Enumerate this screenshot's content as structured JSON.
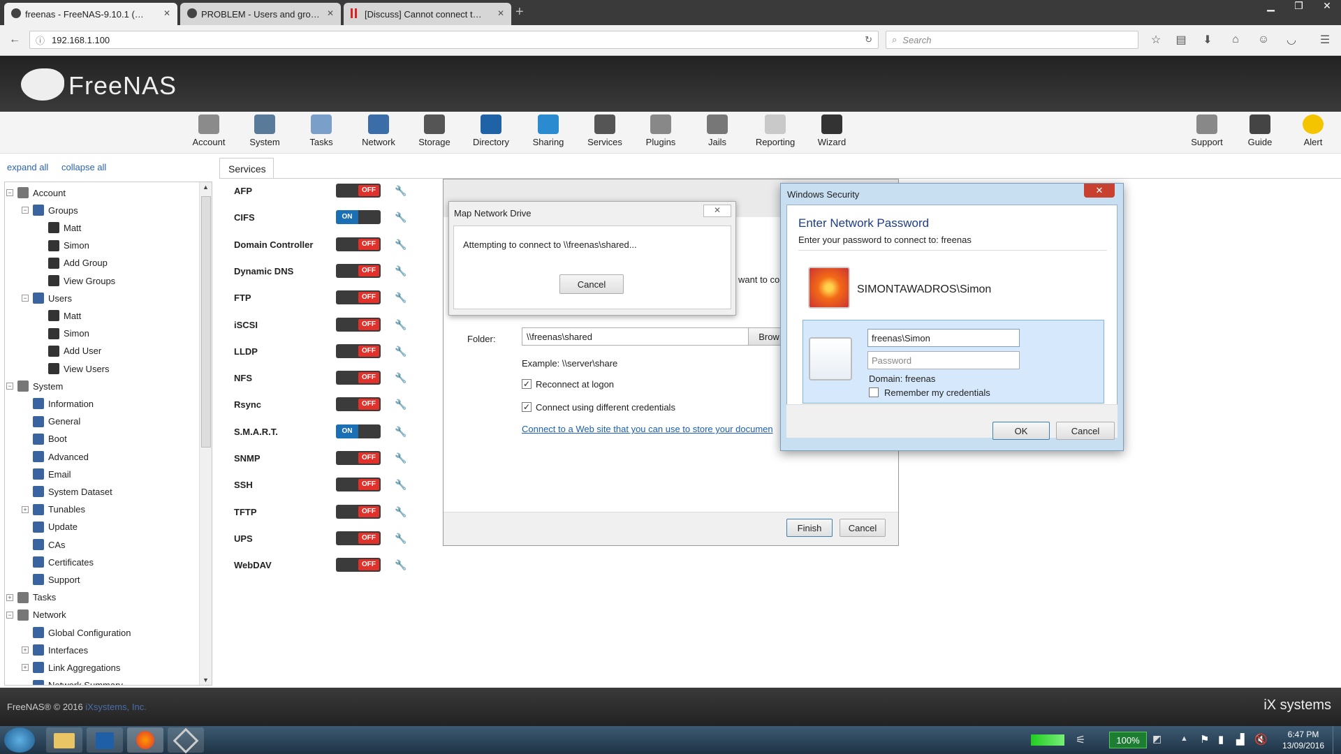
{
  "browser": {
    "tabs": [
      {
        "label": "freenas - FreeNAS-9.10.1 (…"
      },
      {
        "label": "PROBLEM - Users and gro…"
      },
      {
        "label": "[Discuss] Cannot connect t…"
      }
    ],
    "url": "192.168.1.100",
    "search_placeholder": "Search"
  },
  "app": {
    "logo": "FreeNAS",
    "toolbar": [
      "Account",
      "System",
      "Tasks",
      "Network",
      "Storage",
      "Directory",
      "Sharing",
      "Services",
      "Plugins",
      "Jails",
      "Reporting",
      "Wizard"
    ],
    "toolbar_right": [
      "Support",
      "Guide",
      "Alert"
    ],
    "expand_all": "expand all",
    "collapse_all": "collapse all",
    "tab_services": "Services"
  },
  "tree": [
    {
      "label": "Account",
      "level": 0,
      "pm": "−"
    },
    {
      "label": "Groups",
      "level": 1,
      "pm": "−"
    },
    {
      "label": "Matt",
      "level": 2
    },
    {
      "label": "Simon",
      "level": 2
    },
    {
      "label": "Add Group",
      "level": 2
    },
    {
      "label": "View Groups",
      "level": 2
    },
    {
      "label": "Users",
      "level": 1,
      "pm": "−"
    },
    {
      "label": "Matt",
      "level": 2
    },
    {
      "label": "Simon",
      "level": 2
    },
    {
      "label": "Add User",
      "level": 2
    },
    {
      "label": "View Users",
      "level": 2
    },
    {
      "label": "System",
      "level": 0,
      "pm": "−"
    },
    {
      "label": "Information",
      "level": 1
    },
    {
      "label": "General",
      "level": 1
    },
    {
      "label": "Boot",
      "level": 1
    },
    {
      "label": "Advanced",
      "level": 1
    },
    {
      "label": "Email",
      "level": 1
    },
    {
      "label": "System Dataset",
      "level": 1
    },
    {
      "label": "Tunables",
      "level": 1,
      "pm": "+"
    },
    {
      "label": "Update",
      "level": 1
    },
    {
      "label": "CAs",
      "level": 1
    },
    {
      "label": "Certificates",
      "level": 1
    },
    {
      "label": "Support",
      "level": 1
    },
    {
      "label": "Tasks",
      "level": 0,
      "pm": "+"
    },
    {
      "label": "Network",
      "level": 0,
      "pm": "−"
    },
    {
      "label": "Global Configuration",
      "level": 1
    },
    {
      "label": "Interfaces",
      "level": 1,
      "pm": "+"
    },
    {
      "label": "Link Aggregations",
      "level": 1,
      "pm": "+"
    },
    {
      "label": "Network Summary",
      "level": 1
    }
  ],
  "services": [
    {
      "name": "AFP",
      "state": "OFF"
    },
    {
      "name": "CIFS",
      "state": "ON"
    },
    {
      "name": "Domain Controller",
      "state": "OFF"
    },
    {
      "name": "Dynamic DNS",
      "state": "OFF"
    },
    {
      "name": "FTP",
      "state": "OFF"
    },
    {
      "name": "iSCSI",
      "state": "OFF"
    },
    {
      "name": "LLDP",
      "state": "OFF"
    },
    {
      "name": "NFS",
      "state": "OFF"
    },
    {
      "name": "Rsync",
      "state": "OFF"
    },
    {
      "name": "S.M.A.R.T.",
      "state": "ON"
    },
    {
      "name": "SNMP",
      "state": "OFF"
    },
    {
      "name": "SSH",
      "state": "OFF"
    },
    {
      "name": "TFTP",
      "state": "OFF"
    },
    {
      "name": "UPS",
      "state": "OFF"
    },
    {
      "name": "WebDAV",
      "state": "OFF"
    }
  ],
  "map_drive_bg": {
    "want_to": "want to co",
    "folder_label": "Folder:",
    "folder_value": "\\\\freenas\\shared",
    "browse": "Brow",
    "example": "Example: \\\\server\\share",
    "reconnect": "Reconnect at logon",
    "different_creds": "Connect using different credentials",
    "web_link": "Connect to a Web site that you can use to store your documen",
    "finish": "Finish",
    "cancel": "Cancel"
  },
  "map_progress": {
    "title": "Map Network Drive",
    "message": "Attempting to connect to \\\\freenas\\shared...",
    "cancel": "Cancel"
  },
  "win_security": {
    "title": "Windows Security",
    "heading": "Enter Network Password",
    "subtitle": "Enter your password to connect to: freenas",
    "user_name": "SIMONTAWADROS\\Simon",
    "username_value": "freenas\\Simon",
    "password_placeholder": "Password",
    "domain": "Domain: freenas",
    "remember": "Remember my credentials",
    "ok": "OK",
    "cancel": "Cancel"
  },
  "footer": {
    "copyright": "FreeNAS® © 2016 ",
    "company": "iXsystems, Inc.",
    "brand": "iX systems"
  },
  "taskbar": {
    "battery": "100%",
    "time": "6:47 PM",
    "date": "13/09/2016"
  },
  "colors": {
    "accent": "#1b6fb5",
    "off": "#e0312b",
    "link": "#1a5fb4"
  }
}
